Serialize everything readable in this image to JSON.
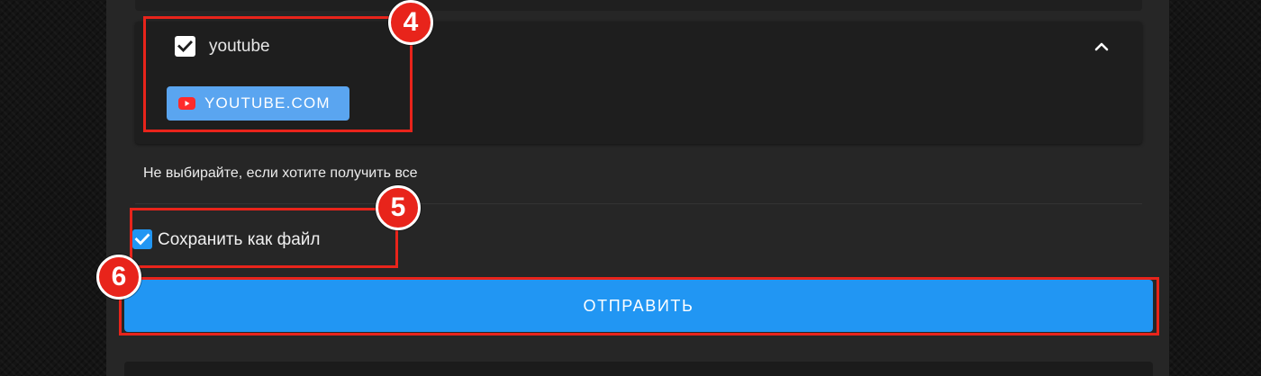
{
  "filter": {
    "item_label": "youtube",
    "item_checked": true,
    "expanded": true,
    "chip_label": "YOUTUBE.COM",
    "hint": "Не выбирайте, если хотите получить все"
  },
  "save_as_file": {
    "label": "Сохранить как файл",
    "checked": true
  },
  "submit": {
    "label": "ОТПРАВИТЬ"
  },
  "annotations": {
    "badge_4": "4",
    "badge_5": "5",
    "badge_6": "6"
  },
  "colors": {
    "accent_blue": "#2196f3",
    "chip_blue": "#5aa5f0",
    "annotation_red": "#e8241b",
    "youtube_red": "#ff2b2b"
  },
  "icons": {
    "chevron": "chevron-up-icon",
    "checkbox": "check-icon",
    "chip": "youtube-play-icon"
  }
}
